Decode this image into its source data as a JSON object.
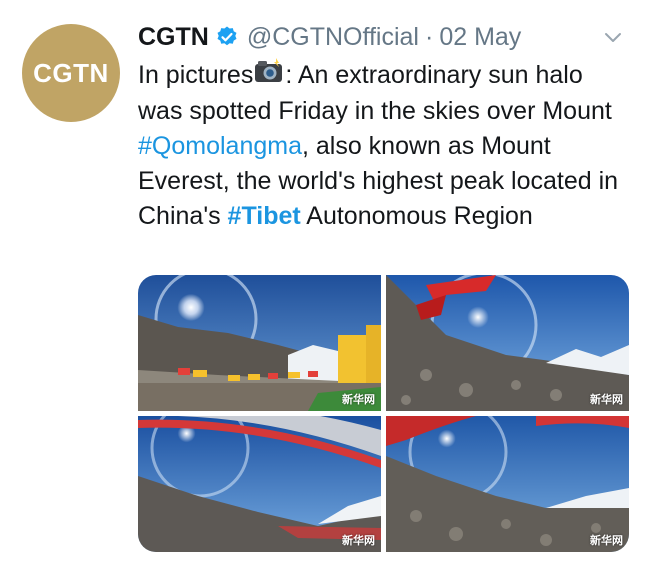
{
  "account": {
    "avatar_text": "CGTN",
    "name": "CGTN",
    "handle": "@CGTNOfficial",
    "separator": "·",
    "date": "02 May",
    "verified_icon": "verified-badge-icon",
    "menu_icon": "chevron-down-icon"
  },
  "tweet": {
    "part1": "In pictures",
    "part2": ": An extraordinary sun halo was spotted Friday in the skies over Mount ",
    "hashtag1": "#Qomolangma",
    "part3": ", also known as Mount Everest, the world's highest peak located in China's ",
    "hashtag2": "#Tibet",
    "part4": " Autonomous Region",
    "emoji_icon": "camera-with-flash-icon"
  },
  "media": {
    "watermark": "新华网",
    "photos": [
      {
        "description": "sun-halo-over-camp"
      },
      {
        "description": "sun-halo-with-flags"
      },
      {
        "description": "sun-halo-fisheye-flags"
      },
      {
        "description": "sun-halo-rocky-slope"
      }
    ]
  },
  "colors": {
    "avatar_bg": "#c0a465",
    "link": "#1b95e0",
    "secondary": "#657786",
    "text": "#14171a"
  }
}
